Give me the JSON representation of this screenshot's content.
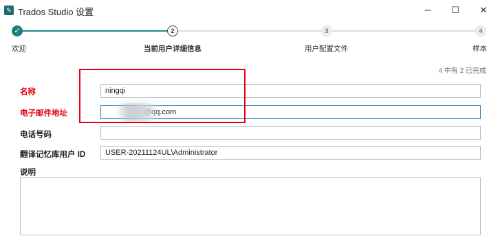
{
  "window": {
    "title": "Trados Studio 设置",
    "icon": "trados-app-icon",
    "minimize": "─",
    "maximize": "☐",
    "close": "✕"
  },
  "steps": [
    {
      "number": "✓",
      "label": "欢迎",
      "state": "done"
    },
    {
      "number": "2",
      "label": "当前用户详细信息",
      "state": "current"
    },
    {
      "number": "3",
      "label": "用户配置文件",
      "state": "future"
    },
    {
      "number": "4",
      "label": "样本",
      "state": "future"
    }
  ],
  "progress_text": "4 中有 2 已完成",
  "form": {
    "name_label": "名称",
    "name_value": "ningqi",
    "email_label": "电子邮件地址",
    "email_value": "@qq.com",
    "phone_label": "电话号码",
    "phone_value": "",
    "tm_user_label": "翻译记忆库用户 ID",
    "tm_user_value": "USER-20211124UL\\Administrator",
    "description_label": "说明",
    "description_value": ""
  },
  "colors": {
    "accent": "#1f7f7a",
    "highlight": "#e60012",
    "focus_border": "#2f84c8"
  }
}
